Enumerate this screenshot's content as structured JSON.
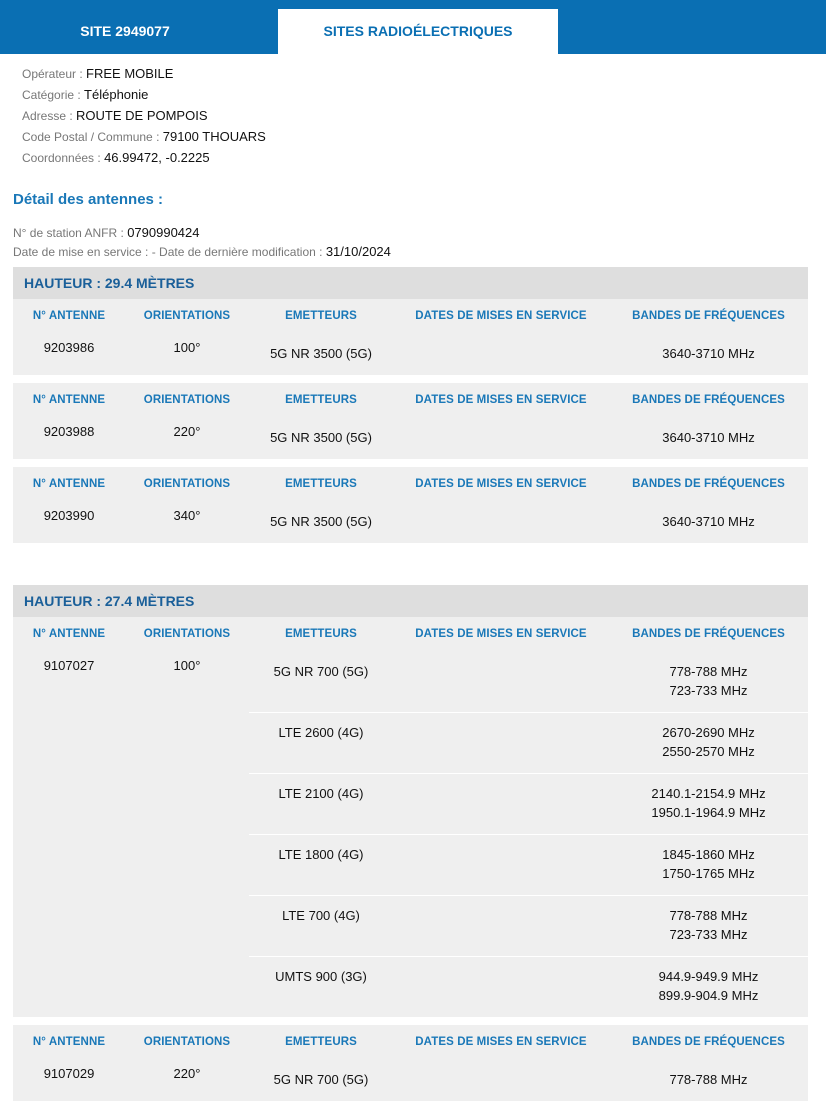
{
  "tabs": {
    "site": "SITE 2949077",
    "radio": "SITES RADIOÉLECTRIQUES"
  },
  "info": [
    {
      "label": "Opérateur : ",
      "value": "FREE MOBILE"
    },
    {
      "label": "Catégorie : ",
      "value": "Téléphonie"
    },
    {
      "label": "Adresse : ",
      "value": "ROUTE DE POMPOIS"
    },
    {
      "label": "Code Postal / Commune : ",
      "value": "79100 THOUARS"
    },
    {
      "label": "Coordonnées : ",
      "value": "46.99472, -0.2225"
    }
  ],
  "section_title": "Détail des antennes :",
  "station": {
    "anfr_label": "N° de station ANFR : ",
    "anfr_value": "0790990424",
    "dates_label": "Date de mise en service :  -  Date de dernière modification : ",
    "dates_value": "31/10/2024"
  },
  "headers": {
    "antenne": "N° ANTENNE",
    "orientations": "ORIENTATIONS",
    "emetteurs": "EMETTEURS",
    "dates": "DATES DE MISES EN SERVICE",
    "bandes": "BANDES DE FRÉQUENCES"
  },
  "heights": [
    {
      "title": "HAUTEUR : 29.4 MÈTRES",
      "antennas": [
        {
          "id": "9203986",
          "orientation": "100°",
          "emitters": [
            {
              "name": "5G NR 3500 (5G)",
              "date": "",
              "bands": [
                "3640-3710 MHz"
              ]
            }
          ]
        },
        {
          "id": "9203988",
          "orientation": "220°",
          "emitters": [
            {
              "name": "5G NR 3500 (5G)",
              "date": "",
              "bands": [
                "3640-3710 MHz"
              ]
            }
          ]
        },
        {
          "id": "9203990",
          "orientation": "340°",
          "emitters": [
            {
              "name": "5G NR 3500 (5G)",
              "date": "",
              "bands": [
                "3640-3710 MHz"
              ]
            }
          ]
        }
      ]
    },
    {
      "title": "HAUTEUR : 27.4 MÈTRES",
      "antennas": [
        {
          "id": "9107027",
          "orientation": "100°",
          "emitters": [
            {
              "name": "5G NR 700 (5G)",
              "date": "",
              "bands": [
                "778-788 MHz",
                "723-733 MHz"
              ]
            },
            {
              "name": "LTE 2600 (4G)",
              "date": "",
              "bands": [
                "2670-2690 MHz",
                "2550-2570 MHz"
              ]
            },
            {
              "name": "LTE 2100 (4G)",
              "date": "",
              "bands": [
                "2140.1-2154.9 MHz",
                "1950.1-1964.9 MHz"
              ]
            },
            {
              "name": "LTE 1800 (4G)",
              "date": "",
              "bands": [
                "1845-1860 MHz",
                "1750-1765 MHz"
              ]
            },
            {
              "name": "LTE 700 (4G)",
              "date": "",
              "bands": [
                "778-788 MHz",
                "723-733 MHz"
              ]
            },
            {
              "name": "UMTS 900 (3G)",
              "date": "",
              "bands": [
                "944.9-949.9 MHz",
                "899.9-904.9 MHz"
              ]
            }
          ]
        },
        {
          "id": "9107029",
          "orientation": "220°",
          "emitters": [
            {
              "name": "5G NR 700 (5G)",
              "date": "",
              "bands": [
                "778-788 MHz"
              ]
            }
          ]
        }
      ]
    }
  ]
}
